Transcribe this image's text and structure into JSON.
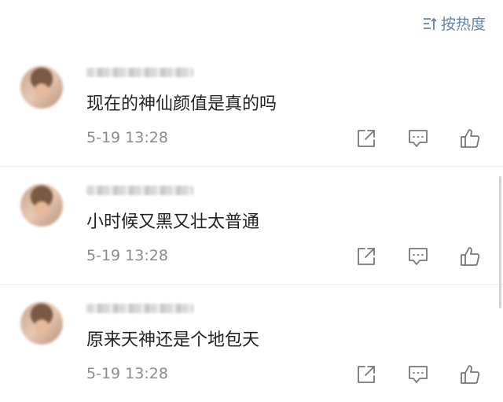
{
  "sort": {
    "label": "按热度",
    "icon": "sort-icon"
  },
  "comments": [
    {
      "avatar": "blurred-avatar",
      "username": "blurred",
      "text": "现在的神仙颜值是真的吗",
      "time": "5-19 13:28"
    },
    {
      "avatar": "blurred-avatar",
      "username": "blurred",
      "text": "小时候又黑又壮太普通",
      "time": "5-19 13:28"
    },
    {
      "avatar": "blurred-avatar",
      "username": "blurred",
      "text": "原来天神还是个地包天",
      "time": "5-19 13:28"
    }
  ],
  "action_icons": [
    "share-icon",
    "reply-icon",
    "like-icon"
  ],
  "colors": {
    "accent": "#5f87ad",
    "text": "#222222",
    "meta": "#8b8b8b",
    "divider": "#eceff2"
  }
}
